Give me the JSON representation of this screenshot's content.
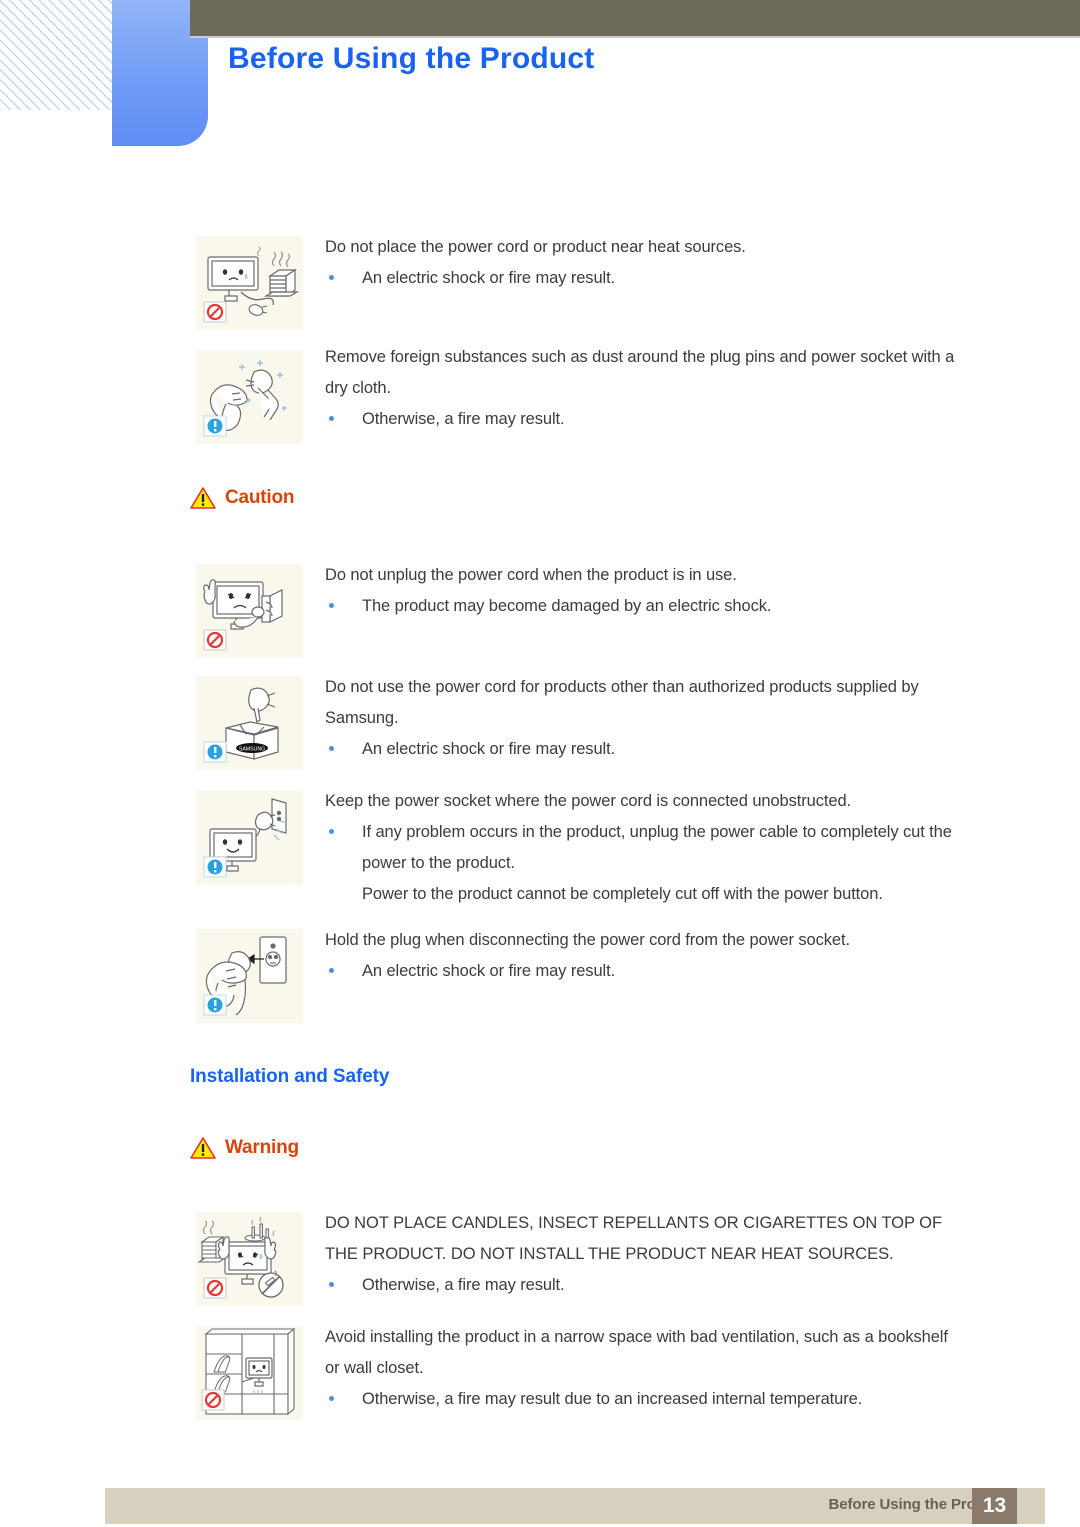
{
  "header": {
    "title": "Before Using the Product",
    "title_color": "#1a63f0",
    "bar_color": "#6d6a57",
    "tab_color": "#6e9bf6"
  },
  "sections": [
    {
      "id": "power-warning-continued",
      "items": [
        {
          "icon": "monitor-heater-prohibited-illustration",
          "badge": "prohibited-icon",
          "lead": "Do not place the power cord or product near heat sources.",
          "bullets": [
            "An electric shock or fire may result."
          ]
        },
        {
          "icon": "hand-cleaning-plug-illustration",
          "badge": "info-icon",
          "lead": "Remove foreign substances such as dust around the plug pins and power socket with a dry cloth.",
          "bullets": [
            "Otherwise, a fire may result."
          ]
        }
      ]
    },
    {
      "id": "caution",
      "heading": "Caution",
      "heading_icon": "warning-triangle-icon",
      "heading_color": "#d9440a",
      "items": [
        {
          "icon": "monitor-unplug-prohibited-illustration",
          "badge": "prohibited-icon",
          "lead": "Do not unplug the power cord when the product is in use.",
          "bullets": [
            "The product may become damaged by an electric shock."
          ]
        },
        {
          "icon": "plug-samsung-box-illustration",
          "badge": "info-icon",
          "lead": "Do not use the power cord for products other than authorized products supplied by Samsung.",
          "bullets": [
            "An electric shock or fire may result."
          ]
        },
        {
          "icon": "monitor-socket-unobstructed-illustration",
          "badge": "info-icon",
          "lead": "Keep the power socket where the power cord is connected unobstructed.",
          "bullets": [
            "If any problem occurs in the product, unplug the power cable to completely cut the power to the product."
          ],
          "plain": [
            "Power to the product cannot be completely cut off with the power button."
          ]
        },
        {
          "icon": "hand-holding-plug-socket-illustration",
          "badge": "info-icon",
          "lead": "Hold the plug when disconnecting the power cord from the power socket.",
          "bullets": [
            "An electric shock or fire may result."
          ]
        }
      ]
    },
    {
      "id": "installation-and-safety",
      "blue_heading": "Installation and Safety",
      "heading": "Warning",
      "heading_icon": "warning-triangle-icon",
      "heading_color": "#d9440a",
      "items": [
        {
          "icon": "candles-cigarettes-on-monitor-prohibited-illustration",
          "badge": "prohibited-icon",
          "lead": "DO NOT PLACE CANDLES, INSECT REPELLANTS OR CIGARETTES ON TOP OF THE PRODUCT. DO NOT INSTALL THE PRODUCT NEAR HEAT SOURCES.",
          "bullets": [
            "Otherwise, a fire may result."
          ]
        },
        {
          "icon": "monitor-in-bookshelf-prohibited-illustration",
          "badge": "prohibited-icon",
          "lead": "Avoid installing the product in a narrow space with bad ventilation, such as a bookshelf or wall closet.",
          "bullets": [
            "Otherwise, a fire may result due to an increased internal temperature."
          ]
        }
      ]
    }
  ],
  "footer": {
    "label": "Before Using the Product",
    "page_number": "13",
    "bar_color": "#d6d1bf",
    "page_box_color": "#8a7a6c"
  }
}
